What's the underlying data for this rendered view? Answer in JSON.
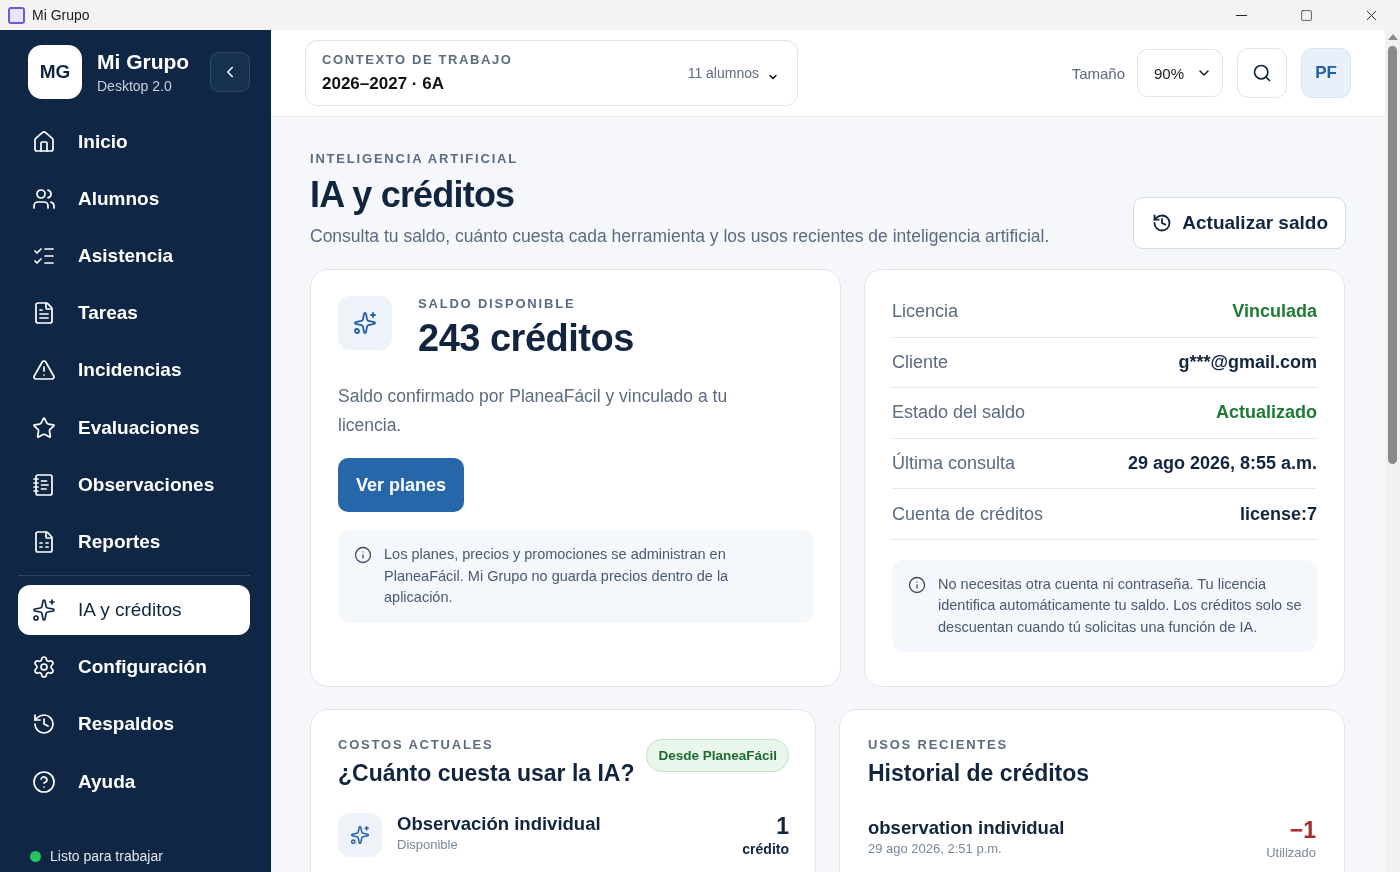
{
  "window": {
    "title": "Mi Grupo"
  },
  "sidebar": {
    "logo": "MG",
    "app_name": "Mi Grupo",
    "version": "Desktop 2.0",
    "groups": [
      {
        "items": [
          {
            "label": "Inicio",
            "selected": false
          },
          {
            "label": "Alumnos",
            "selected": false
          },
          {
            "label": "Asistencia",
            "selected": false
          },
          {
            "label": "Tareas",
            "selected": false
          },
          {
            "label": "Incidencias",
            "selected": false
          },
          {
            "label": "Evaluaciones",
            "selected": false
          },
          {
            "label": "Observaciones",
            "selected": false
          },
          {
            "label": "Reportes",
            "selected": false
          }
        ]
      },
      {
        "items": [
          {
            "label": "IA y créditos",
            "selected": true
          },
          {
            "label": "Configuración",
            "selected": false
          },
          {
            "label": "Respaldos",
            "selected": false
          },
          {
            "label": "Ayuda",
            "selected": false
          }
        ]
      }
    ],
    "status": {
      "text": "Listo para trabajar",
      "color": "#22c55e"
    }
  },
  "header": {
    "context_label": "CONTEXTO DE TRABAJO",
    "context_value": "2026–2027 · 6A",
    "students": "11 alumnos",
    "size_label": "Tamaño",
    "size_value": "90%",
    "avatar": "PF"
  },
  "page": {
    "eyebrow": "INTELIGENCIA ARTIFICIAL",
    "title": "IA y créditos",
    "subtitle": "Consulta tu saldo, cuánto cuesta cada herramienta y los usos recientes de inteligencia artificial.",
    "refresh_button": "Actualizar saldo"
  },
  "balance": {
    "label": "SALDO DISPONIBLE",
    "amount": "243 créditos",
    "description": "Saldo confirmado por PlaneaFácil y vinculado a tu licencia.",
    "button": "Ver planes",
    "note": "Los planes, precios y promociones se administran en PlaneaFácil. Mi Grupo no guarda precios dentro de la aplicación."
  },
  "license": {
    "rows": [
      {
        "label": "Licencia",
        "value": "Vinculada",
        "color": "#1e7b34"
      },
      {
        "label": "Cliente",
        "value": "g***@gmail.com",
        "color": "#12253f"
      },
      {
        "label": "Estado del saldo",
        "value": "Actualizado",
        "color": "#1e7b34"
      },
      {
        "label": "Última consulta",
        "value": "29 ago 2026, 8:55 a.m.",
        "color": "#12253f"
      },
      {
        "label": "Cuenta de créditos",
        "value": "license:7",
        "color": "#12253f"
      }
    ],
    "note": "No necesitas otra cuenta ni contraseña. Tu licencia identifica automáticamente tu saldo. Los créditos solo se descuentan cuando tú solicitas una función de IA."
  },
  "costs": {
    "eyebrow": "COSTOS ACTUALES",
    "title": "¿Cuánto cuesta usar la IA?",
    "badge": "Desde PlaneaFácil",
    "items": [
      {
        "name": "Observación individual",
        "status": "Disponible",
        "amount": "1",
        "unit": "crédito"
      }
    ]
  },
  "history": {
    "eyebrow": "USOS RECIENTES",
    "title": "Historial de créditos",
    "items": [
      {
        "name": "observation individual",
        "date": "29 ago 2026, 2:51 p.m.",
        "amount": "−1",
        "status": "Utilizado"
      }
    ]
  }
}
